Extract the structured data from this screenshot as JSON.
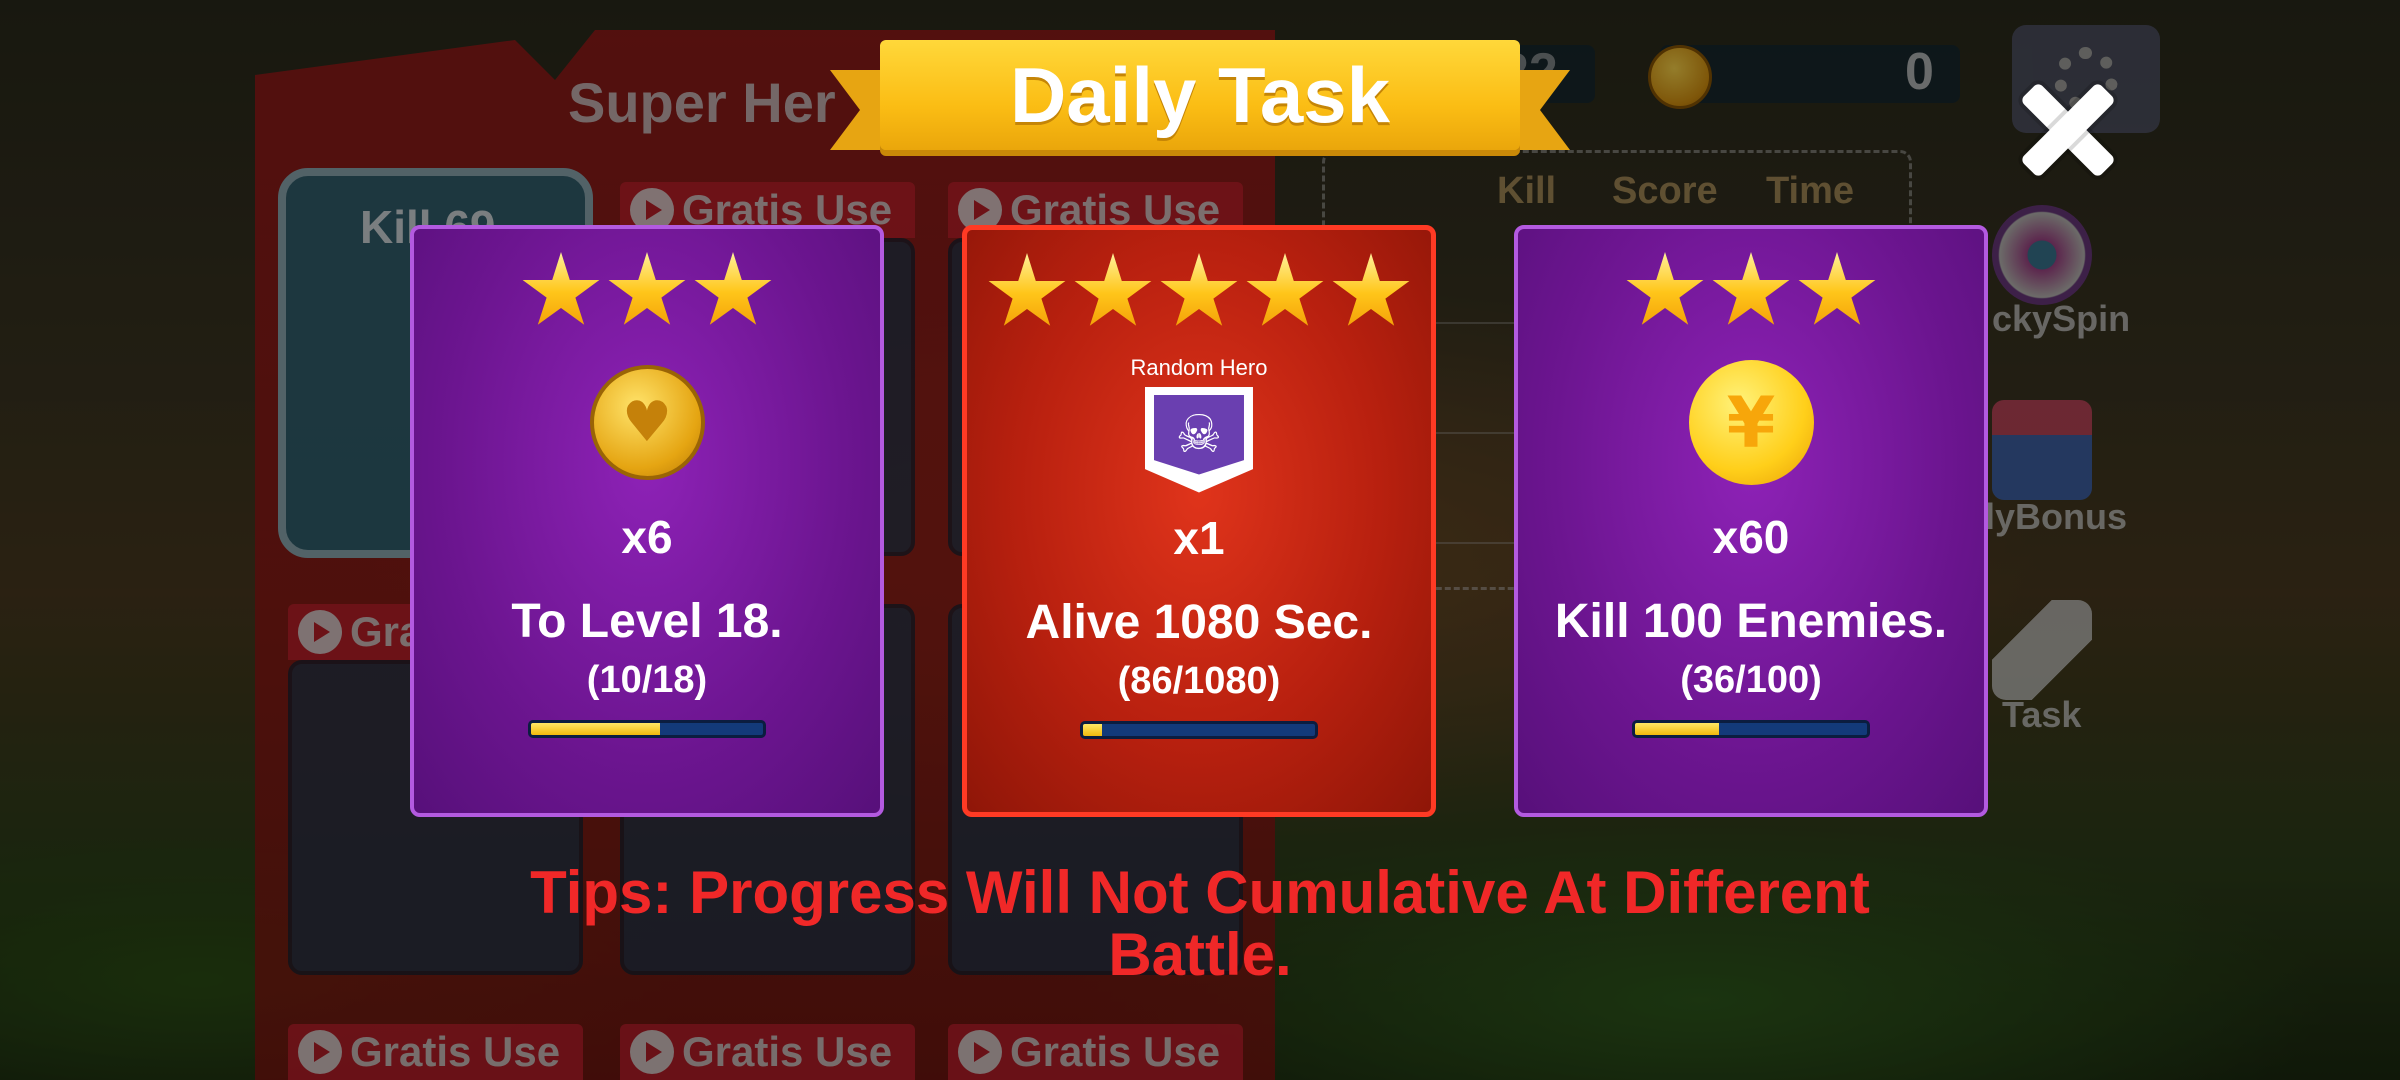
{
  "banner": {
    "title": "Daily Task"
  },
  "background": {
    "panel_title": "Super Her",
    "featured_label": "Kill 69",
    "gratis_label": "Gratis Use",
    "gratis_label_partial": "Gra",
    "board_headers": [
      "Kill",
      "Score",
      "Time"
    ],
    "hud_value": "22",
    "coins": "0",
    "side_menu": [
      "ckySpin",
      "ilyBonus",
      "Task"
    ]
  },
  "cards": [
    {
      "theme": "purple",
      "stars": 3,
      "reward_icon": "heart-coin-icon",
      "reward_count": "x6",
      "task": "To Level 18.",
      "progress_text": "(10/18)",
      "progress": 0.556
    },
    {
      "theme": "red",
      "stars": 5,
      "reward_label": "Random Hero",
      "reward_icon": "skull-shield-icon",
      "reward_count": "x1",
      "task": "Alive 1080 Sec.",
      "progress_text": "(86/1080)",
      "progress": 0.08
    },
    {
      "theme": "purple",
      "stars": 3,
      "reward_icon": "yen-coin-icon",
      "reward_count": "x60",
      "task": "Kill 100 Enemies.",
      "progress_text": "(36/100)",
      "progress": 0.36
    }
  ],
  "tips": {
    "line1": "Tips: Progress Will Not Cumulative At Different",
    "line2": "Battle."
  },
  "colors": {
    "tips": "#f02828",
    "card_purple": "#6c1590",
    "card_red": "#b8200f",
    "progress_fill": "#f2b90c",
    "progress_track": "#133a7a"
  }
}
